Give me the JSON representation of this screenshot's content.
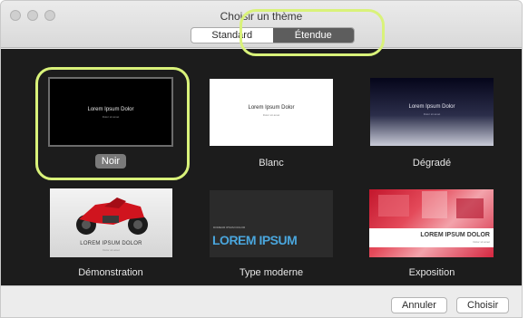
{
  "window": {
    "title": "Choisir un thème"
  },
  "tabs": [
    {
      "label": "Standard"
    },
    {
      "label": "Étendue"
    }
  ],
  "themes": [
    {
      "name": "Noir",
      "thumb_title": "Lorem Ipsum Dolor",
      "thumb_sub": "Dolor sit amet"
    },
    {
      "name": "Blanc",
      "thumb_title": "Lorem Ipsum Dolor",
      "thumb_sub": "Dolor sit amet"
    },
    {
      "name": "Dégradé",
      "thumb_title": "Lorem Ipsum Dolor",
      "thumb_sub": "Dolor sit amet"
    },
    {
      "name": "Démonstration",
      "thumb_title": "LOREM IPSUM DOLOR",
      "thumb_sub": "Dolor sit amet"
    },
    {
      "name": "Type moderne",
      "thumb_title": "LOREM IPSUM",
      "thumb_sub": "DOMEUR IPSUM DOLOR"
    },
    {
      "name": "Exposition",
      "thumb_title": "LOREM IPSUM DOLOR",
      "thumb_sub": "Dolor sit amet"
    }
  ],
  "buttons": {
    "cancel": "Annuler",
    "choose": "Choisir"
  },
  "colors": {
    "highlight": "#d9f27a",
    "selected_tab": "#5d5d5d",
    "content_bg": "#1c1c1c"
  }
}
